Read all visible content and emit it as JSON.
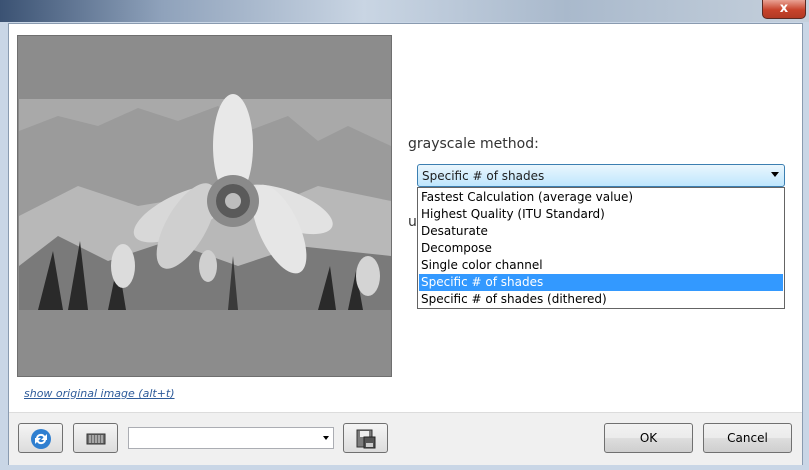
{
  "window": {
    "close_label": "x"
  },
  "preview": {
    "show_original_link": "show original image (alt+t)"
  },
  "settings": {
    "method_label": "grayscale method:",
    "hidden_label": "u",
    "selected_method": "Specific # of shades",
    "options": [
      "Fastest Calculation (average value)",
      "Highest Quality (ITU Standard)",
      "Desaturate",
      "Decompose",
      "Single color channel",
      "Specific # of shades",
      "Specific # of shades (dithered)"
    ],
    "selected_index": 5
  },
  "bottom": {
    "ok_label": "OK",
    "cancel_label": "Cancel",
    "preset_value": ""
  },
  "icons": {
    "refresh": "refresh-icon",
    "presets": "presets-icon",
    "save": "save-icon"
  },
  "colors": {
    "selection": "#3399ff",
    "combo_border": "#3c7fb1",
    "link": "#2e5b9a"
  }
}
